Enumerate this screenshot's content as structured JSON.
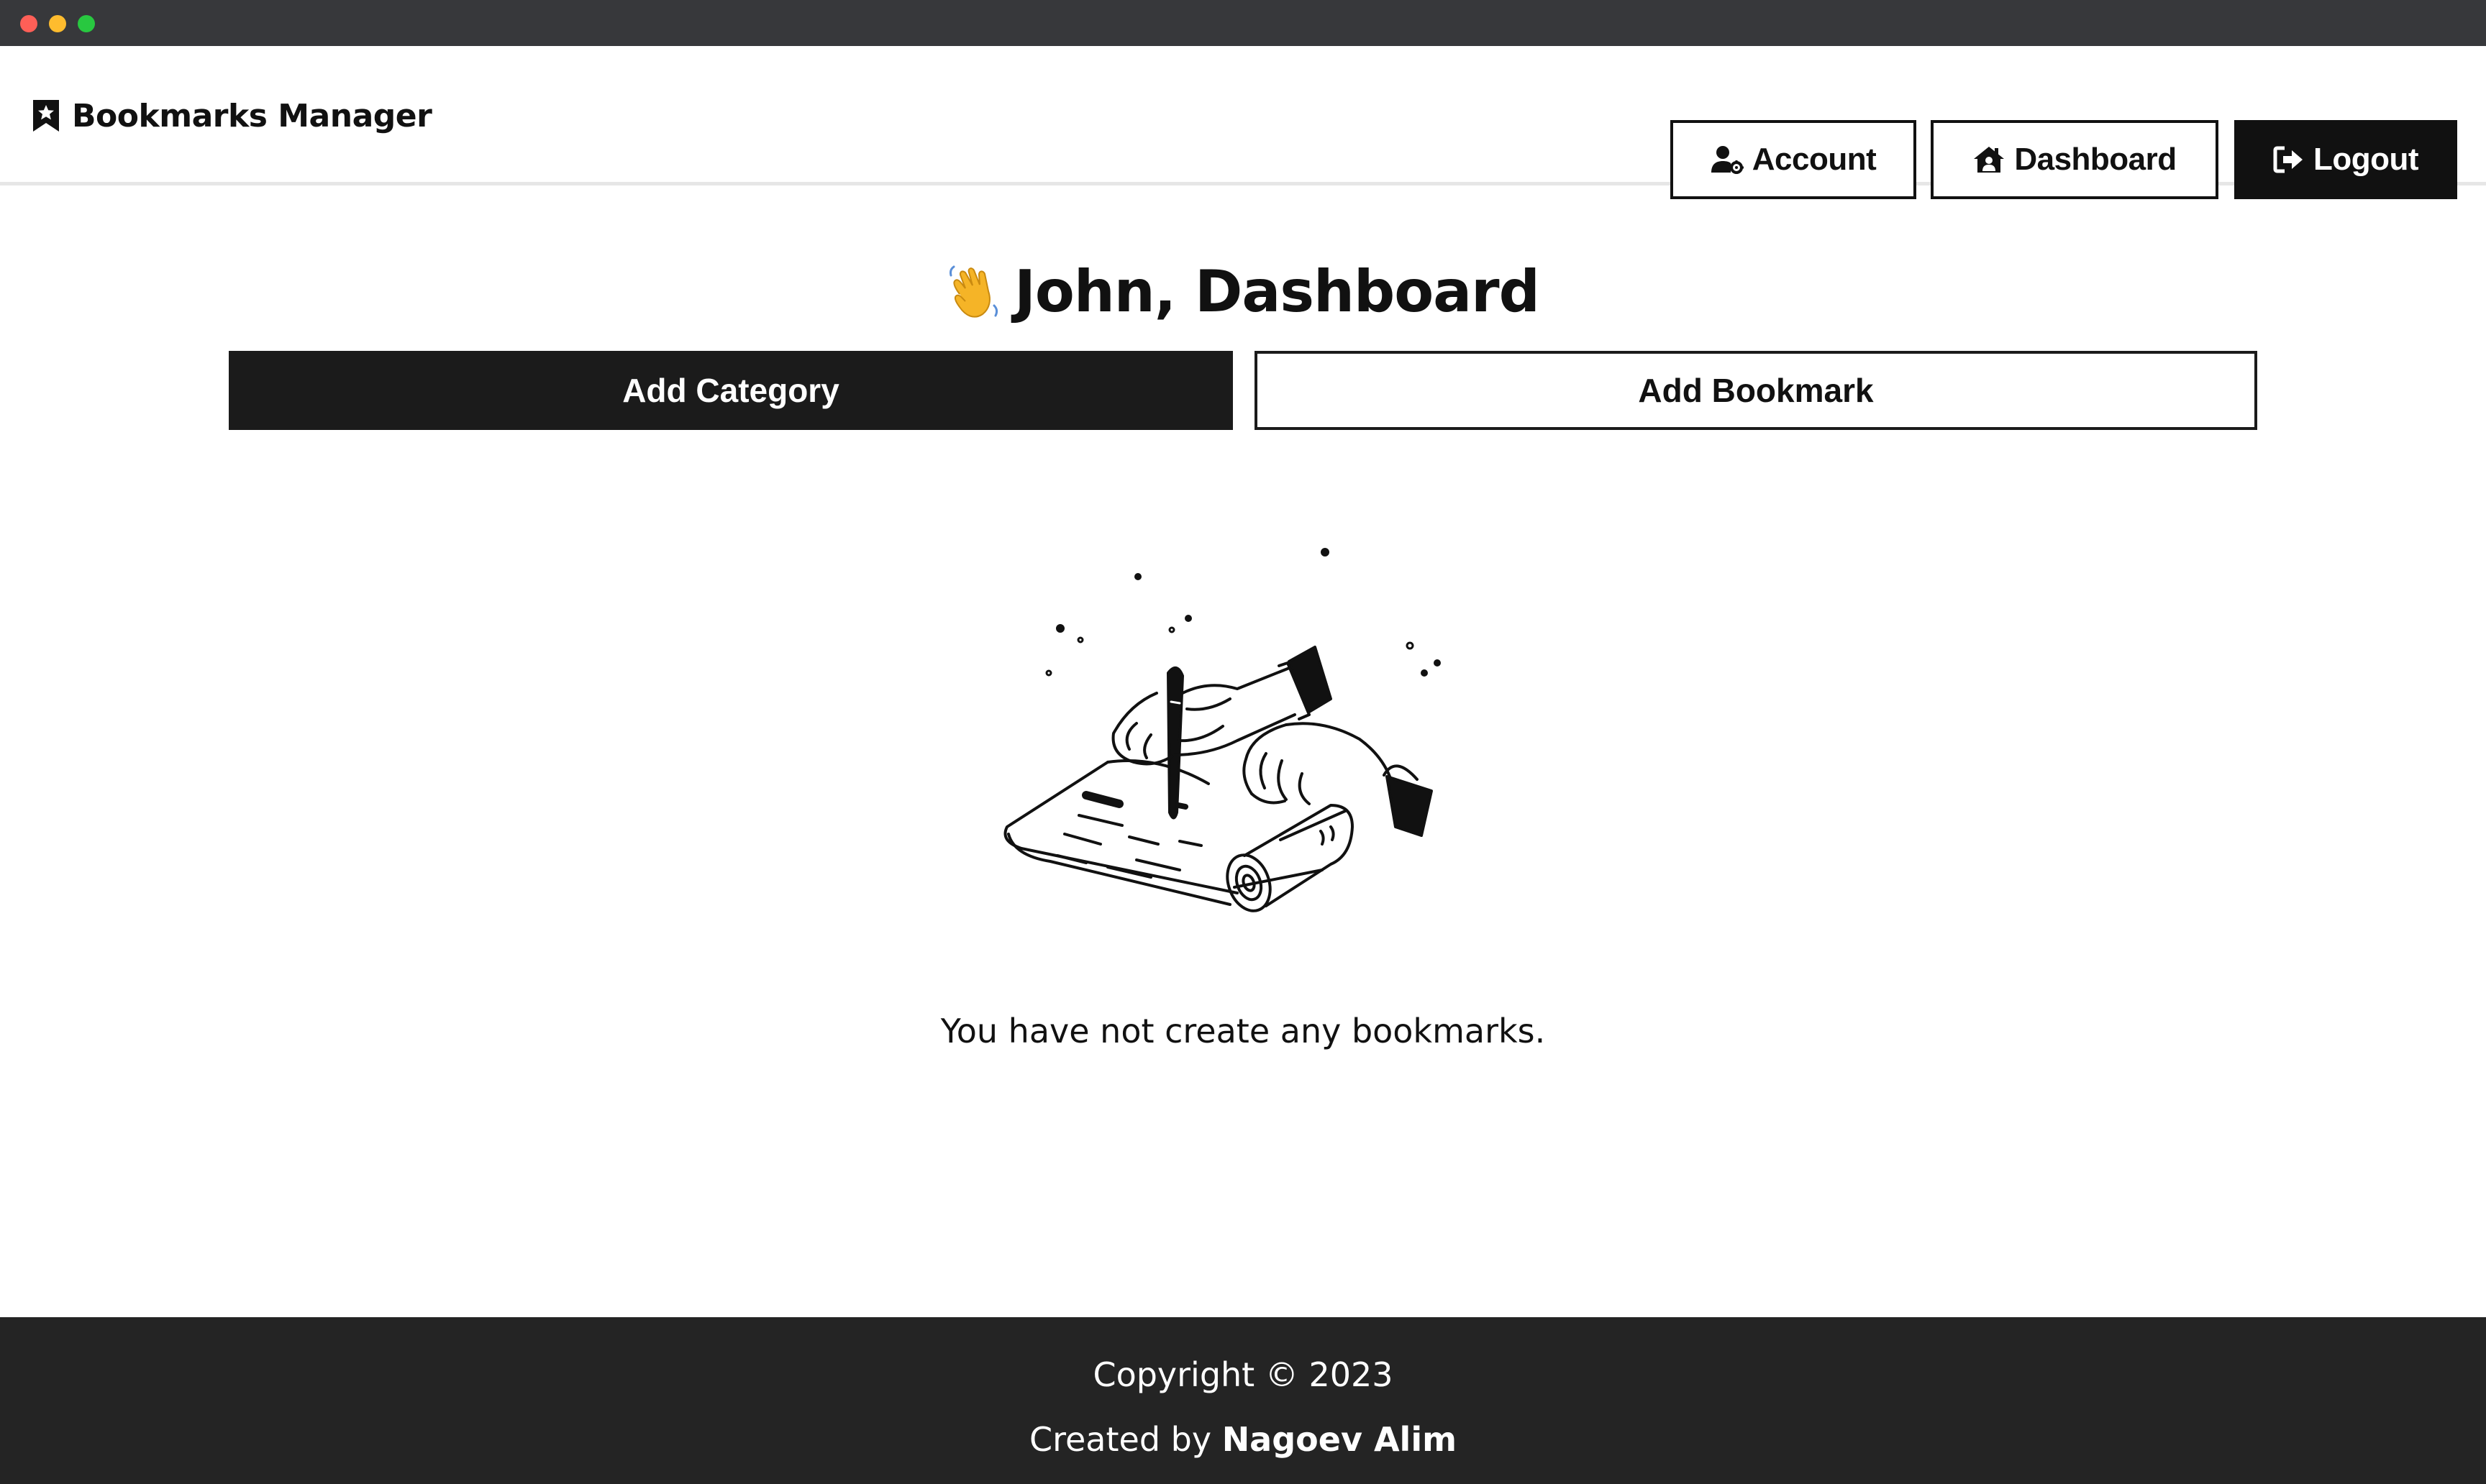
{
  "window": {
    "title": ""
  },
  "navbar": {
    "brand_label": "Bookmarks Manager",
    "brand_icon": "bookmark-star-icon",
    "account_label": "Account",
    "account_icon": "user-gear-icon",
    "dashboard_label": "Dashboard",
    "dashboard_icon": "house-user-icon",
    "logout_label": "Logout",
    "logout_icon": "sign-out-icon"
  },
  "main": {
    "greeting_emoji": "waving-hand-icon",
    "greeting_text": "John, Dashboard",
    "add_category_label": "Add Category",
    "add_bookmark_label": "Add Bookmark",
    "illustration": "hands-writing-on-scroll-illustration",
    "empty_message": "You have not create any bookmarks."
  },
  "footer": {
    "copyright": "Copyright © 2023",
    "created_by_prefix": "Created by",
    "author": "Nagoev Alim"
  },
  "colors": {
    "primary": "#1b1b1b",
    "footer_bg": "#242424",
    "chrome_bg": "#37383b",
    "wave_emoji": "#f5b427"
  }
}
